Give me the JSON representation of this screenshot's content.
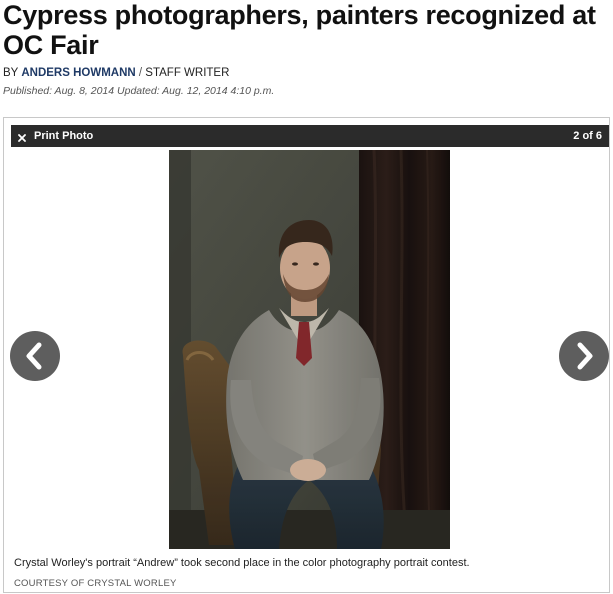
{
  "article": {
    "headline": "Cypress photographers, painters recognized at OC Fair",
    "byline_prefix": "BY ",
    "author": "ANDERS HOWMANN",
    "byline_separator": " / ",
    "author_role": "STAFF WRITER",
    "dateline": "Published: Aug. 8, 2014 Updated: Aug. 12, 2014 4:10 p.m."
  },
  "gallery": {
    "print_label": "Print Photo",
    "print_icon": "close-x-icon",
    "counter": "2 of 6",
    "prev_icon": "chevron-left-icon",
    "next_icon": "chevron-right-icon",
    "caption": "Crystal Worley's portrait “Andrew” took second place in the color photography portrait contest.",
    "credit": "COURTESY OF CRYSTAL WORLEY"
  },
  "colors": {
    "bar_background": "#2b2b2b",
    "author_link": "#1f3a66",
    "nav_button": "#5e5e5e"
  }
}
